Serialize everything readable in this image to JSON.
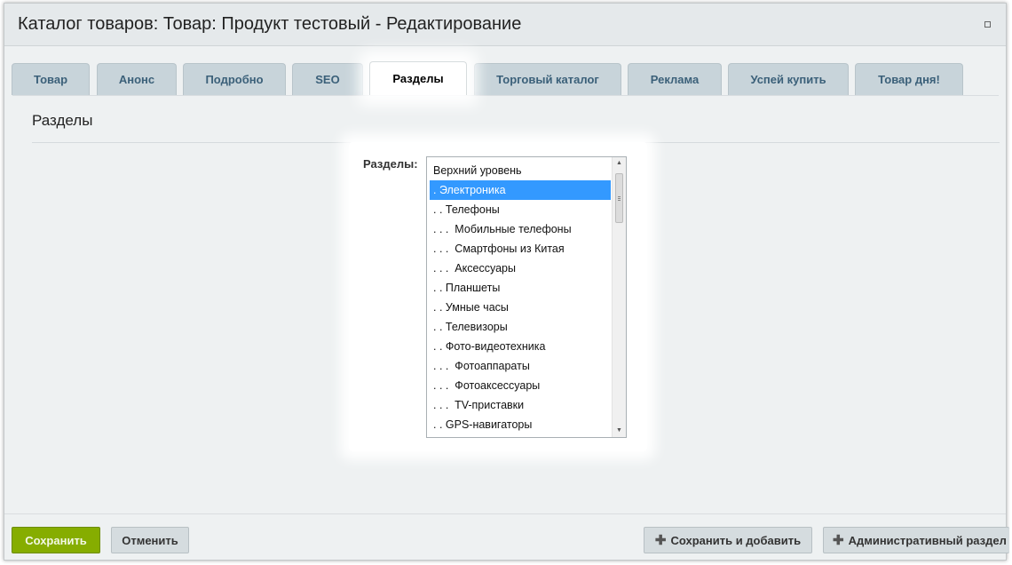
{
  "window": {
    "title": "Каталог товаров: Товар: Продукт тестовый - Редактирование"
  },
  "tabs": [
    {
      "label": "Товар",
      "active": false
    },
    {
      "label": "Анонс",
      "active": false
    },
    {
      "label": "Подробно",
      "active": false
    },
    {
      "label": "SEO",
      "active": false
    },
    {
      "label": "Разделы",
      "active": true
    },
    {
      "label": "Торговый каталог",
      "active": false
    },
    {
      "label": "Реклама",
      "active": false
    },
    {
      "label": "Успей купить",
      "active": false
    },
    {
      "label": "Товар дня!",
      "active": false
    }
  ],
  "section": {
    "title": "Разделы",
    "field_label": "Разделы:"
  },
  "listbox": {
    "selected": ". Электроника",
    "options": [
      "Верхний уровень",
      ". Электроника",
      ". . Телефоны",
      ". . .  Мобильные телефоны",
      ". . .  Смартфоны из Китая",
      ". . .  Аксессуары",
      ". . Планшеты",
      ". . Умные часы",
      ". . Телевизоры",
      ". . Фото-видеотехника",
      ". . .  Фотоаппараты",
      ". . .  Фотоаксессуары",
      ". . .  TV-приставки",
      ". . GPS-навигаторы"
    ]
  },
  "footer": {
    "save_label": "Сохранить",
    "cancel_label": "Отменить",
    "save_add_label": "Сохранить и добавить",
    "admin_label": "Административный раздел"
  },
  "colors": {
    "save_button": "#86ad00",
    "tab_text": "#3b6079",
    "selection": "#3399ff"
  }
}
